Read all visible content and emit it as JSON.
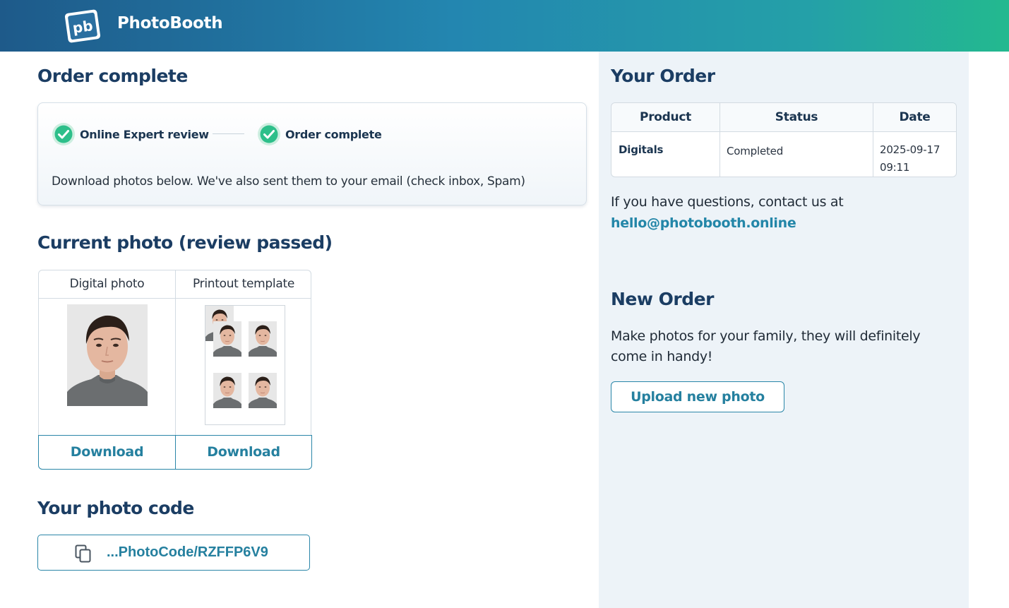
{
  "header": {
    "brand": "PhotoBooth",
    "logo_text": "pb",
    "colors": {
      "gradient_start": "#1e5a8a",
      "gradient_end": "#23b98f"
    }
  },
  "order_complete": {
    "title": "Order complete",
    "steps": [
      {
        "label": "Online Expert review",
        "state": "done",
        "icon": "check-circle-icon"
      },
      {
        "label": "Order complete",
        "state": "done",
        "icon": "check-circle-icon"
      }
    ],
    "note": "Download photos below. We've also sent them to your email (check inbox, Spam)"
  },
  "current_photo": {
    "title": "Current photo (review passed)",
    "columns": [
      {
        "header": "Digital photo",
        "button": "Download"
      },
      {
        "header": "Printout template",
        "button": "Download"
      }
    ]
  },
  "photo_code": {
    "title": "Your photo code",
    "code_text": "...PhotoCode/RZFFP6V9",
    "icon": "copy-icon"
  },
  "your_order": {
    "title": "Your Order",
    "headers": [
      "Product",
      "Status",
      "Date"
    ],
    "rows": [
      {
        "product": "Digitals",
        "status": "Completed",
        "date_line1": "2025-09-17",
        "date_line2": "09:11"
      }
    ],
    "contact_text": "If you have questions, contact us at",
    "contact_email": "hello@photobooth.online"
  },
  "new_order": {
    "title": "New Order",
    "text": "Make photos for your family, they will definitely come in handy!",
    "button": "Upload new photo"
  },
  "colors": {
    "heading": "#1b3d63",
    "accent": "#25809f",
    "check_green": "#2dbf8a",
    "sidebar_bg": "#edf3f8"
  }
}
